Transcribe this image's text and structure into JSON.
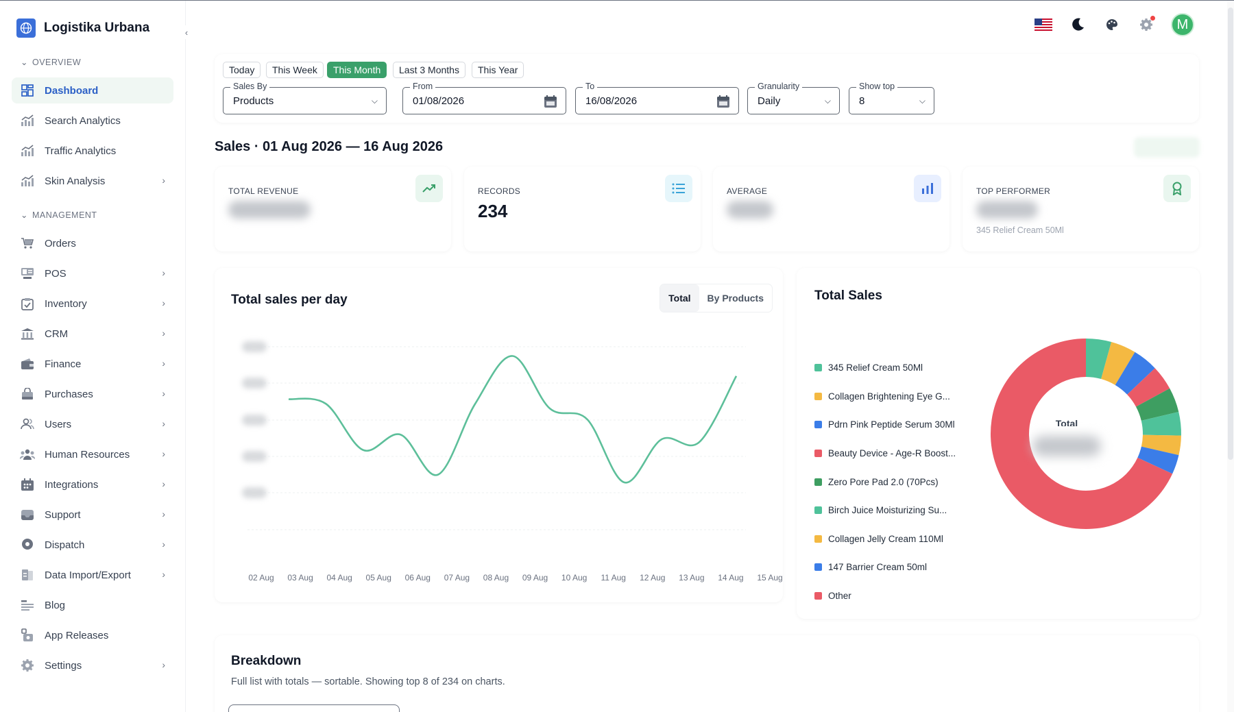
{
  "app": {
    "name": "Logistika Urbana",
    "user_initial": "M"
  },
  "sidebar": {
    "sections": [
      {
        "label": "OVERVIEW"
      },
      {
        "label": "MANAGEMENT"
      }
    ],
    "items": [
      {
        "label": "Dashboard"
      },
      {
        "label": "Search Analytics"
      },
      {
        "label": "Traffic Analytics"
      },
      {
        "label": "Skin Analysis"
      },
      {
        "label": "Orders"
      },
      {
        "label": "POS"
      },
      {
        "label": "Inventory"
      },
      {
        "label": "CRM"
      },
      {
        "label": "Finance"
      },
      {
        "label": "Purchases"
      },
      {
        "label": "Users"
      },
      {
        "label": "Human Resources"
      },
      {
        "label": "Integrations"
      },
      {
        "label": "Support"
      },
      {
        "label": "Dispatch"
      },
      {
        "label": "Data Import/Export"
      },
      {
        "label": "Blog"
      },
      {
        "label": "App Releases"
      },
      {
        "label": "Settings"
      }
    ]
  },
  "filters": {
    "quick": [
      "Today",
      "This Week",
      "This Month",
      "Last 3 Months",
      "This Year"
    ],
    "active_quick": "This Month",
    "sales_by": {
      "label": "Sales By",
      "value": "Products"
    },
    "from": {
      "label": "From",
      "value": "01/08/2026"
    },
    "to": {
      "label": "To",
      "value": "16/08/2026"
    },
    "granularity": {
      "label": "Granularity",
      "value": "Daily"
    },
    "show_top": {
      "label": "Show top",
      "value": "8"
    }
  },
  "page": {
    "title": "Sales · 01 Aug 2026 — 16 Aug 2026"
  },
  "stats": [
    {
      "label": "TOTAL REVENUE",
      "value": "",
      "sub": ""
    },
    {
      "label": "RECORDS",
      "value": "234",
      "sub": ""
    },
    {
      "label": "AVERAGE",
      "value": "",
      "sub": ""
    },
    {
      "label": "TOP PERFORMER",
      "value": "",
      "sub": "345 Relief Cream 50Ml"
    }
  ],
  "line_chart": {
    "title": "Total sales per day",
    "toggle": [
      "Total",
      "By Products"
    ],
    "active_toggle": "Total"
  },
  "donut": {
    "title": "Total Sales",
    "center_label": "Total"
  },
  "breakdown": {
    "title": "Breakdown",
    "description": "Full list with totals — sortable. Showing top 8 of 234 on charts."
  },
  "colors": {
    "accent": "#3aa06a",
    "line": "#5dbf9a",
    "primary": "#2b5fc6"
  },
  "chart_data": [
    {
      "type": "line",
      "title": "Total sales per day",
      "x": [
        "02 Aug",
        "03 Aug",
        "04 Aug",
        "05 Aug",
        "06 Aug",
        "07 Aug",
        "08 Aug",
        "09 Aug",
        "10 Aug",
        "11 Aug",
        "12 Aug",
        "13 Aug",
        "14 Aug",
        "15 Aug"
      ],
      "series": [
        {
          "values": [
            0.66,
            0.63,
            0.33,
            0.43,
            0.17,
            0.63,
            0.94,
            0.6,
            0.53,
            0.12,
            0.4,
            0.38,
            0.81,
            null
          ]
        }
      ],
      "ylim": [
        0,
        1
      ],
      "grid": true
    },
    {
      "type": "pie",
      "title": "Total Sales",
      "labels": [
        "345 Relief Cream 50Ml",
        "Collagen Brightening Eye G...",
        "Pdrn Pink Peptide Serum 30Ml",
        "Beauty Device - Age-R Boost...",
        "Zero Pore Pad 2.0 (70Pcs)",
        "Birch Juice Moisturizing Su...",
        "Collagen Jelly Cream 110Ml",
        "147 Barrier Cream 50ml",
        "Other"
      ],
      "values": [
        4.3,
        4.3,
        4.3,
        4.2,
        4.2,
        4.0,
        3.3,
        3.3,
        68.1
      ],
      "colors": [
        "#4fc29a",
        "#f4b942",
        "#3b7de8",
        "#ea5a66",
        "#3e9e61",
        "#4fc29a",
        "#f4b942",
        "#3b7de8",
        "#ea5a66"
      ]
    }
  ]
}
